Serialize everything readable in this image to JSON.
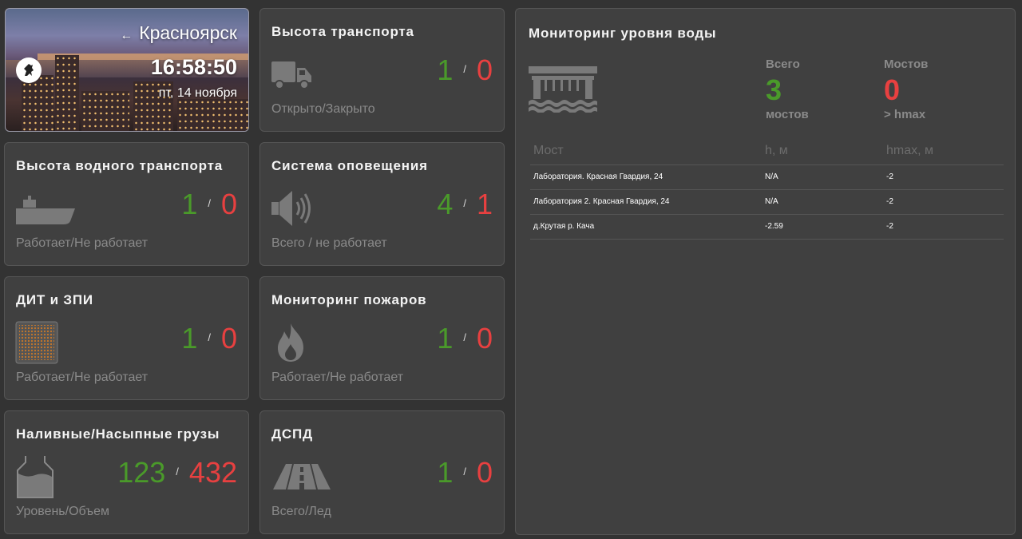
{
  "city": {
    "back_icon": "←",
    "name": "Красноярск",
    "time": "16:58:50",
    "date": "пт, 14 ноября",
    "logo_icon": "city-emblem-icon"
  },
  "cards": {
    "truck": {
      "title": "Высота транспорта",
      "ok": "1",
      "bad": "0",
      "sep": "/",
      "subtitle": "Открыто/Закрыто",
      "icon": "truck-icon"
    },
    "ship": {
      "title": "Высота водного транспорта",
      "ok": "1",
      "bad": "0",
      "sep": "/",
      "subtitle": "Работает/Не работает",
      "icon": "ship-icon"
    },
    "alert": {
      "title": "Система оповещения",
      "ok": "4",
      "bad": "1",
      "sep": "/",
      "subtitle": "Всего / не работает",
      "icon": "speaker-icon"
    },
    "dit": {
      "title": "ДИТ и ЗПИ",
      "ok": "1",
      "bad": "0",
      "sep": "/",
      "subtitle": "Работает/Не работает",
      "icon": "led-board-icon"
    },
    "fire": {
      "title": "Мониторинг пожаров",
      "ok": "1",
      "bad": "0",
      "sep": "/",
      "subtitle": "Работает/Не работает",
      "icon": "fire-icon"
    },
    "cargo": {
      "title": "Наливные/Насыпные грузы",
      "ok": "123",
      "bad": "432",
      "sep": "/",
      "subtitle": "Уровень/Объем",
      "icon": "tank-icon"
    },
    "dspd": {
      "title": "ДСПД",
      "ok": "1",
      "bad": "0",
      "sep": "/",
      "subtitle": "Всего/Лед",
      "icon": "road-icon"
    }
  },
  "water": {
    "title": "Мониторинг уровня воды",
    "icon": "bridge-water-icon",
    "total_label": "Всего",
    "total_value": "3",
    "total_sub": "мостов",
    "bridges_label": "Мостов",
    "bridges_value": "0",
    "bridges_sub": "> hmax",
    "columns": [
      "Мост",
      "h, м",
      "hmax, м"
    ],
    "rows": [
      [
        "Лаборатория. Красная Гвардия, 24",
        "N/A",
        "-2"
      ],
      [
        "Лаборатория 2. Красная Гвардия, 24",
        "N/A",
        "-2"
      ],
      [
        "д.Крутая р. Кача",
        "-2.59",
        "-2"
      ]
    ]
  },
  "colors": {
    "background": "#333333",
    "card": "#404040",
    "ok": "#4a9a2a",
    "bad": "#e84040",
    "muted": "#8a8a8a"
  }
}
